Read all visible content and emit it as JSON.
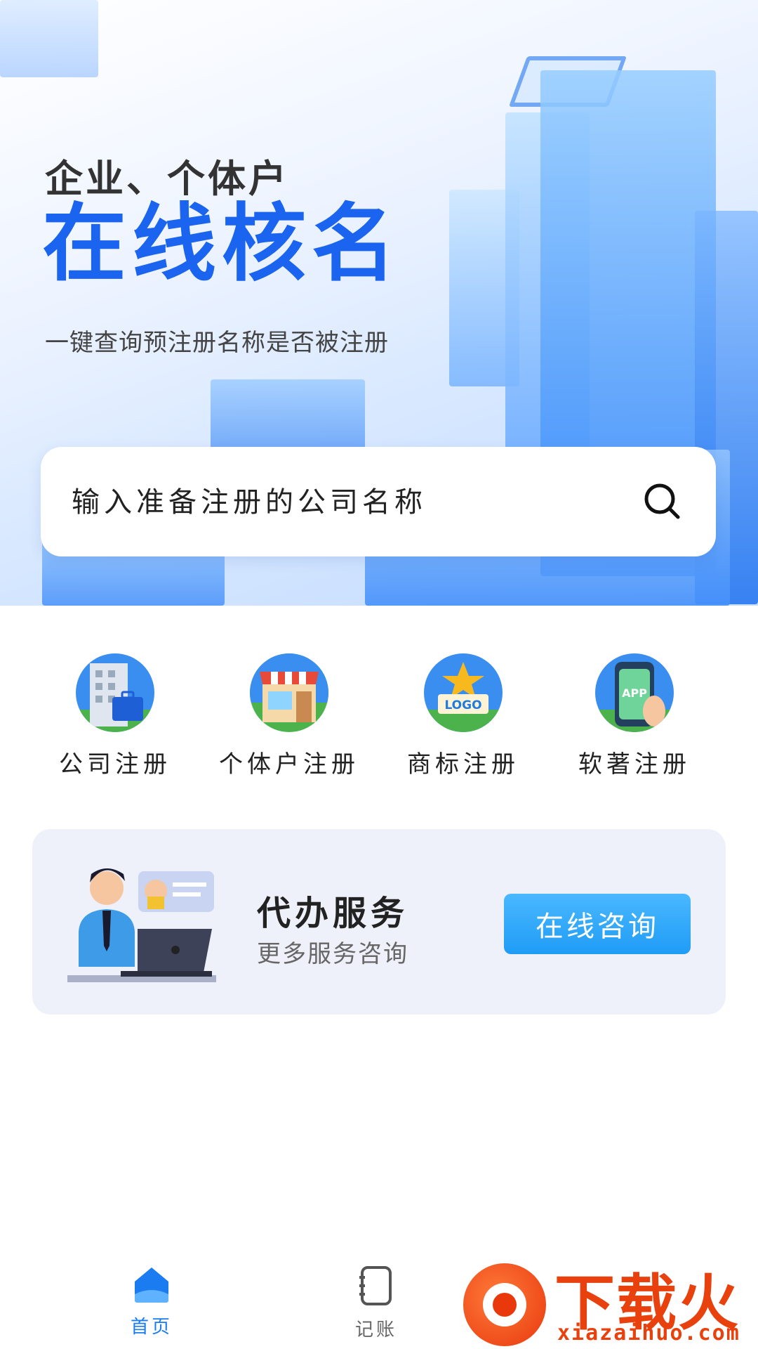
{
  "hero": {
    "subtitle": "企业、个体户",
    "title": "在线核名",
    "description": "一键查询预注册名称是否被注册"
  },
  "search": {
    "placeholder": "输入准备注册的公司名称",
    "icon": "search-icon"
  },
  "services": [
    {
      "label": "公司注册",
      "icon": "office-building-icon"
    },
    {
      "label": "个体户注册",
      "icon": "storefront-icon"
    },
    {
      "label": "商标注册",
      "icon": "logo-star-icon"
    },
    {
      "label": "软著注册",
      "icon": "phone-app-icon"
    }
  ],
  "agent_card": {
    "title": "代办服务",
    "subtitle": "更多服务咨询",
    "button_label": "在线咨询"
  },
  "bottom_nav": {
    "items": [
      {
        "label": "首页",
        "icon": "home-icon",
        "active": true
      },
      {
        "label": "记账",
        "icon": "notebook-icon",
        "active": false
      }
    ]
  },
  "watermark": {
    "brand": "下载火",
    "url": "xiazaihuo.com"
  },
  "colors": {
    "accent": "#1a64f0",
    "button": "#2ea8fa",
    "nav_active": "#1a7cf0",
    "watermark": "#e8410e"
  }
}
